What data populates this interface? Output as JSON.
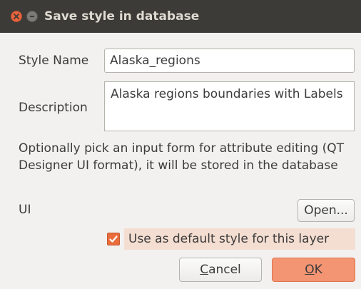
{
  "window": {
    "title": "Save style in database"
  },
  "form": {
    "style_name_label": "Style Name",
    "style_name_value": "Alaska_regions",
    "description_label": "Description",
    "description_value": "Alaska regions boundaries with Labels",
    "info_text": "Optionally pick an input form for attribute editing (QT Designer UI format), it will be stored in the database",
    "ui_label": "UI",
    "open_button": "Open...",
    "default_checkbox_label": "Use as default style for this layer",
    "default_checkbox_checked": true
  },
  "buttons": {
    "cancel_mnemonic": "C",
    "cancel_rest": "ancel",
    "ok_mnemonic": "O",
    "ok_rest": "K"
  },
  "colors": {
    "titlebar": "#3c3b37",
    "accent": "#ea6c3c",
    "ok_button": "#f39472",
    "checkbox_highlight": "#f4ddd1"
  }
}
